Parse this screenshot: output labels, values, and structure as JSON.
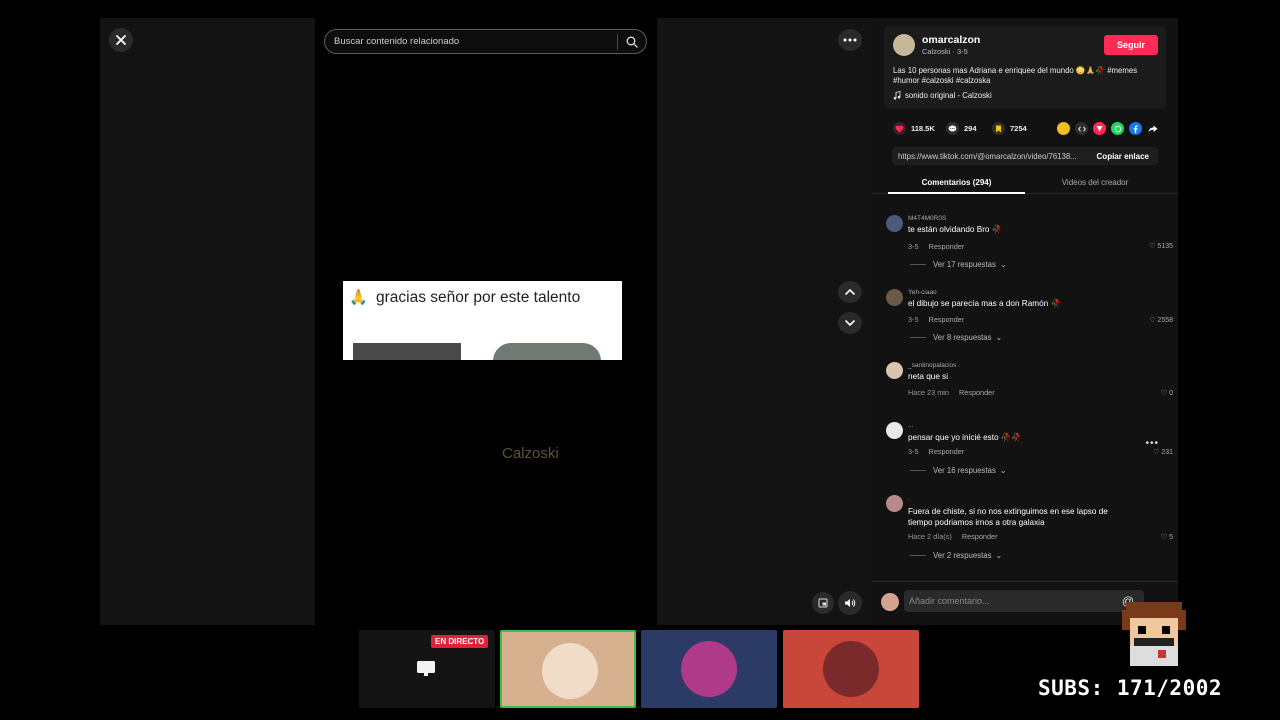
{
  "search": {
    "placeholder": "Buscar contenido relacionado"
  },
  "video": {
    "card_text": "gracias señor por este talento",
    "card_emoji": "🙏",
    "watermark": "Calzoski"
  },
  "author": {
    "name": "omarcalzon",
    "meta": "Calzoski · 3-5",
    "follow_label": "Seguir",
    "description": "Las 10 personas mas Adriana e enriquee del mundo 😳🙏🥀 #memes #humor #calzoski #calzoska",
    "sound": "sonido original - Calzoski"
  },
  "stats": {
    "likes": "118.5K",
    "comments": "294",
    "saves": "7254"
  },
  "share": {
    "link": "https://www.tiktok.com/@omarcalzon/video/76138...",
    "copy_label": "Copiar enlace",
    "icons": [
      "coin-icon",
      "embed-icon",
      "send-icon",
      "whatsapp-icon",
      "facebook-icon",
      "share-arrow-icon"
    ]
  },
  "tabs": {
    "comments": "Comentarios (294)",
    "creator": "Videos del creador"
  },
  "comments": [
    {
      "user": "M4T4M0R0S",
      "text": "te están olvidando Bro 🥀",
      "time": "3-5",
      "reply": "Responder",
      "likes": "5135",
      "replies": "Ver 17 respuestas"
    },
    {
      "user": "Yeh-ciaao",
      "text": "el dibujo se parecía mas a don Ramón 🥀",
      "time": "3-5",
      "reply": "Responder",
      "likes": "2558",
      "replies": "Ver 8 respuestas"
    },
    {
      "user": "_santinopalacios",
      "text": "neta que si",
      "time": "Hace 23 min",
      "reply": "Responder",
      "likes": "0"
    },
    {
      "user": "...",
      "text": "pensar que yo inicié esto 🥀🥀",
      "time": "3-5",
      "reply": "Responder",
      "likes": "231",
      "replies": "Ver 16 respuestas"
    },
    {
      "user": ".",
      "text": "Fuera de chiste, si no nos extinguimos en ese lapso de tiempo podriamos irnos a otra galaxia",
      "time": "Hace 2 día(s)",
      "reply": "Responder",
      "likes": "5",
      "replies": "Ver 2 respuestas"
    }
  ],
  "comment_box": {
    "placeholder": "Añadir comentario...",
    "mention": "@"
  },
  "overlay": {
    "live_badge": "EN DIRECTO",
    "subs": "SUBS: 171/2002"
  },
  "colors": {
    "follow": "#fe2c55",
    "like": "#fe2c55",
    "live": "#e3203b",
    "selected_border": "#3cbf4a"
  }
}
